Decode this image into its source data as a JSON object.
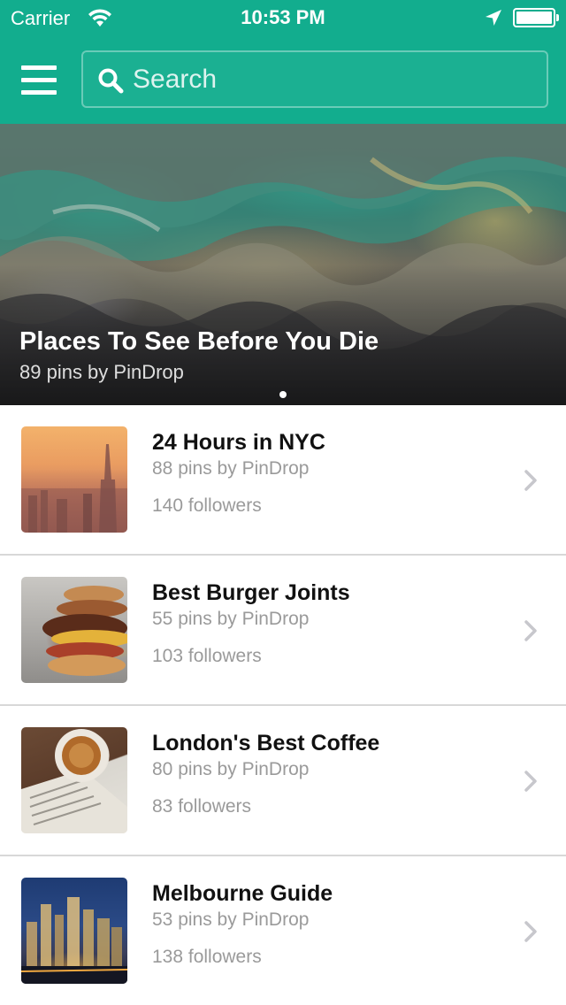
{
  "status_bar": {
    "carrier": "Carrier",
    "time": "10:53 PM"
  },
  "nav": {
    "search_placeholder": "Search"
  },
  "featured": {
    "title": "Places To See Before You Die",
    "subtitle": "89 pins by PinDrop",
    "page_count": 1,
    "current_page": 1
  },
  "boards": [
    {
      "title": "24 Hours in NYC",
      "pins": "88 pins by PinDrop",
      "followers": "140 followers",
      "thumbnail": "nyc-skyline-photo"
    },
    {
      "title": "Best Burger Joints",
      "pins": "55 pins by PinDrop",
      "followers": "103 followers",
      "thumbnail": "burger-photo"
    },
    {
      "title": "London's Best Coffee",
      "pins": "80 pins by PinDrop",
      "followers": "83 followers",
      "thumbnail": "coffee-photo"
    },
    {
      "title": "Melbourne Guide",
      "pins": "53 pins by PinDrop",
      "followers": "138 followers",
      "thumbnail": "melbourne-skyline-photo"
    }
  ],
  "colors": {
    "brand": "#12ad8e",
    "title_text": "#111111",
    "secondary_text": "#9a9a9a",
    "divider": "#d8d8d8",
    "chevron": "#c7c7cc"
  }
}
